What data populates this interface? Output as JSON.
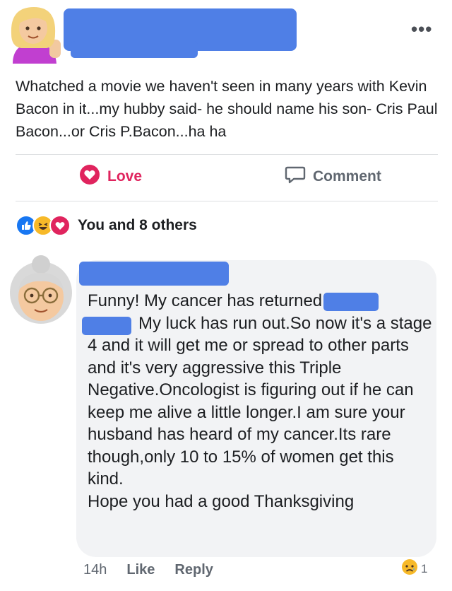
{
  "post": {
    "text": "Whatched a movie we haven't seen in many years with Kevin Bacon in it...my hubby said- he should name his son- Cris Paul Bacon...or Cris P.Bacon...ha ha",
    "more_icon": "more-dots-icon",
    "more_label": "•••"
  },
  "actions": {
    "love_label": "Love",
    "comment_label": "Comment"
  },
  "reactions": {
    "icons": [
      "like-icon",
      "haha-icon",
      "love-icon"
    ],
    "summary": "You and 8 others"
  },
  "comment": {
    "line1": "Funny! My cancer has returned",
    "body": "My luck has run out.So now it's a stage 4 and it will get me or spread to other parts and it's very aggressive this Triple Negative.Oncologist is figuring out if he can keep me alive a little longer.I am sure your husband has heard of my cancer.Its rare though,only 10 to 15% of women get this kind.",
    "closing": "Hope you had a good Thanksgiving",
    "time": "14h",
    "like_label": "Like",
    "reply_label": "Reply",
    "reaction_icon": "sad-icon",
    "reaction_count": "1"
  },
  "colors": {
    "redaction": "#4f7fe6",
    "love": "#e0245e",
    "like": "#1877f2",
    "bubble": "#f2f3f5"
  }
}
